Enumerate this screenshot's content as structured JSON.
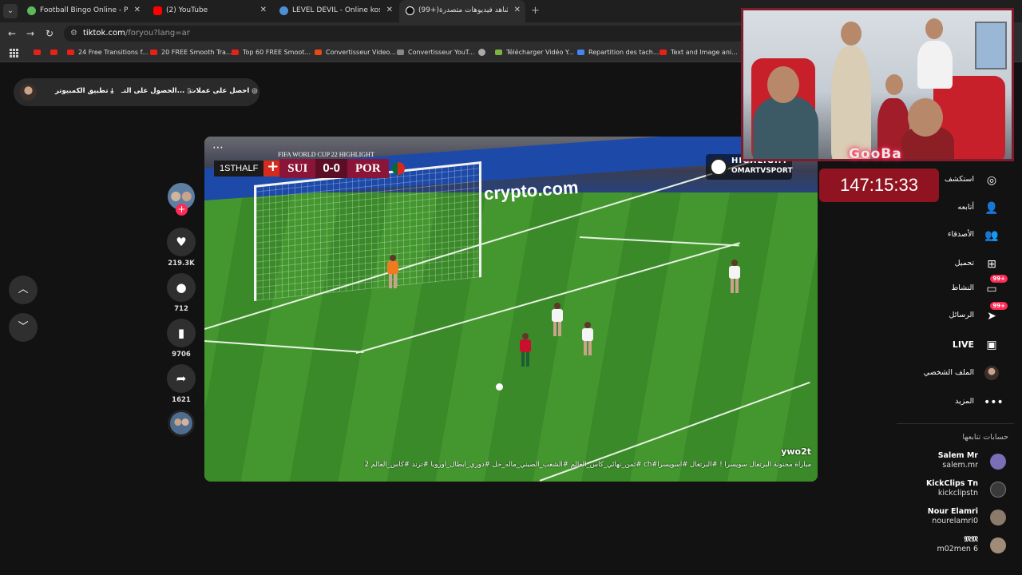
{
  "browser": {
    "tabs": [
      {
        "label": "Football Bingo Online - Play No",
        "favicon_color": "#5cb85c"
      },
      {
        "label": "(2) YouTube",
        "favicon_color": "#ff0000"
      },
      {
        "label": "LEVEL DEVIL - Online kostenlos",
        "favicon_color": "#4d8fd6"
      },
      {
        "label": "(99+)شاهد فيديوهات متصدرة | ",
        "favicon_color": "#ffffff"
      }
    ],
    "url_host": "tiktok.com",
    "url_path": "/foryou?lang=ar",
    "bookmarks": [
      {
        "label": ""
      },
      {
        "label": ""
      },
      {
        "label": "24 Free Transitions f..."
      },
      {
        "label": "20 FREE Smooth Tra..."
      },
      {
        "label": "Top 60 FREE Smoot..."
      },
      {
        "label": "Convertisseur Video..."
      },
      {
        "label": "Convertisseur YouT..."
      },
      {
        "label": ""
      },
      {
        "label": "Télécharger Vidéo Y..."
      },
      {
        "label": "Repartition des tach..."
      },
      {
        "label": "Text and Image ani..."
      }
    ]
  },
  "topbar": {
    "coins_label": "احصل على عملات",
    "get_app_label": "الحصول على التـ...",
    "desktop_app_label": "تطبيق الكمبيوتر"
  },
  "video": {
    "scorebug": {
      "header": "FIFA WORLD CUP 22 HIGHLIGHT",
      "period": "1STHALF",
      "home": "SUI",
      "score": "0-0",
      "away": "POR"
    },
    "ad_board": "crypto.com",
    "channel_logo_line1": "HIGHLIGHT",
    "channel_logo_line2": "OMARTVSPORT",
    "author": "ywo2t",
    "caption": "مباراة مجنونة البرتغال سويسرا ! #البرتغال #اسويسرا#ch #ثمن_نهائي_كاس_العالم #الشعب_الصيني_ماله_حل #دوري_ابطال_اوروبا #ترند #كاس_العالم 2022"
  },
  "actions": {
    "likes": "219.3K",
    "comments": "712",
    "saves": "9706",
    "shares": "1621"
  },
  "stream_overlay": {
    "name": "GooBa",
    "timer": "147:15:33"
  },
  "sidebar": {
    "items": [
      {
        "label": "استكشف",
        "icon": "compass-icon"
      },
      {
        "label": "أتابعه",
        "icon": "user-follow-icon"
      },
      {
        "label": "الأصدقاء",
        "icon": "friends-icon"
      },
      {
        "label": "تحميل",
        "icon": "upload-icon"
      },
      {
        "label": "النشاط",
        "icon": "activity-icon",
        "badge": "99+"
      },
      {
        "label": "الرسائل",
        "icon": "messages-icon",
        "badge": "99+"
      },
      {
        "label": "LIVE",
        "icon": "live-icon"
      },
      {
        "label": "الملف الشخصي",
        "icon": "profile-icon"
      },
      {
        "label": "المزيد",
        "icon": "more-icon"
      }
    ],
    "following_title": "حسابات تتابعها",
    "following": [
      {
        "name": "Salem Mr",
        "handle": "salem.mr",
        "color": "#7a6fb5"
      },
      {
        "name": "KickClips Tn",
        "handle": "kickclipstn",
        "color": "#3a3a3a"
      },
      {
        "name": "Nour Elamri",
        "handle": "nourelamri0",
        "color": "#8c7a6b"
      },
      {
        "name": "𝔐𝔐",
        "handle": "m02men 6",
        "color": "#a08a78"
      }
    ]
  },
  "colors": {
    "accent": "#fe2c55",
    "timer_bg": "#8f1321",
    "scorebug_team": "#8a1538"
  }
}
